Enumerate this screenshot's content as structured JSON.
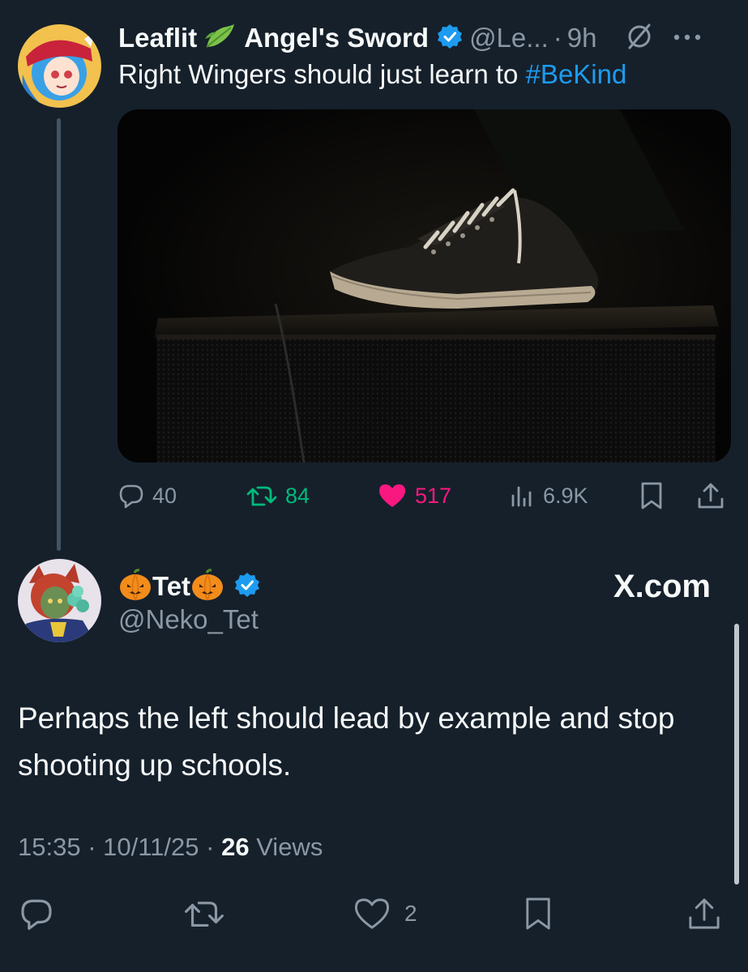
{
  "parent_tweet": {
    "display_name": "Leaflit",
    "display_name_suffix": "Angel's Sword",
    "handle": "@Le...",
    "time": "9h",
    "text_prefix": "Right Wingers should just learn to ",
    "hashtag": "#BeKind",
    "stats": {
      "replies": "40",
      "retweets": "84",
      "likes": "517",
      "views": "6.9K"
    }
  },
  "reply_tweet": {
    "display_name": "Tet",
    "handle": "@Neko_Tet",
    "watermark": "X.com",
    "body": "Perhaps the left should lead by example and stop shooting up schools.",
    "time": "15:35",
    "date": "10/11/25",
    "views_count": "26",
    "views_label": "Views",
    "stats": {
      "likes": "2"
    }
  },
  "colors": {
    "background": "#15202b",
    "accent": "#1d9bf0",
    "retweet": "#00ba7c",
    "like": "#f91880",
    "secondary_text": "#8b98a5"
  },
  "icons": [
    "leaf-icon",
    "verified-badge-icon",
    "grok-icon",
    "more-icon",
    "reply-icon",
    "retweet-icon",
    "heart-icon",
    "views-icon",
    "bookmark-icon",
    "share-icon",
    "pumpkin-icon"
  ]
}
